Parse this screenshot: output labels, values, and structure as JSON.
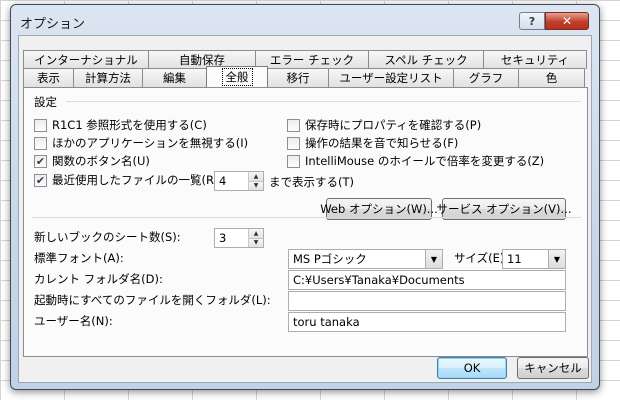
{
  "window": {
    "title": "オプション",
    "help_glyph": "?",
    "close_glyph": "✕"
  },
  "tabs": {
    "back_row": [
      "インターナショナル",
      "自動保存",
      "エラー チェック",
      "スペル チェック",
      "セキュリティ"
    ],
    "front_row": [
      "表示",
      "計算方法",
      "編集",
      "全般",
      "移行",
      "ユーザー設定リスト",
      "グラフ",
      "色"
    ],
    "active": "全般"
  },
  "settings": {
    "section_title": "設定",
    "r1c1": {
      "label": "R1C1 参照形式を使用する(C)",
      "checked": false
    },
    "ignore_other_apps": {
      "label": "ほかのアプリケーションを無視する(I)",
      "checked": false
    },
    "function_tooltips": {
      "label": "関数のボタン名(U)",
      "checked": true
    },
    "recent_files": {
      "label": "最近使用したファイルの一覧(R):",
      "checked": true,
      "count": "4",
      "suffix": "まで表示する(T)"
    },
    "prompt_properties": {
      "label": "保存時にプロパティを確認する(P)",
      "checked": false
    },
    "sound_feedback": {
      "label": "操作の結果を音で知らせる(F)",
      "checked": false
    },
    "intellimouse_zoom": {
      "label": "IntelliMouse のホイールで倍率を変更する(Z)",
      "checked": false
    },
    "web_options_button": "Web オプション(W)...",
    "service_options_button": "サービス オプション(V)..."
  },
  "workbook": {
    "sheets_label": "新しいブックのシート数(S):",
    "sheets_value": "3",
    "font_label": "標準フォント(A):",
    "font_value": "MS Pゴシック",
    "size_label": "サイズ(E):",
    "size_value": "11",
    "default_folder_label": "カレント フォルダ名(D):",
    "default_folder_value": "C:¥Users¥Tanaka¥Documents",
    "startup_folder_label": "起動時にすべてのファイルを開くフォルダ(L):",
    "startup_folder_value": "",
    "username_label": "ユーザー名(N):",
    "username_value": "toru tanaka"
  },
  "footer": {
    "ok": "OK",
    "cancel": "キャンセル"
  },
  "icons": {
    "check": "✔",
    "spin_up": "▲",
    "spin_down": "▼",
    "dropdown": "▼"
  }
}
